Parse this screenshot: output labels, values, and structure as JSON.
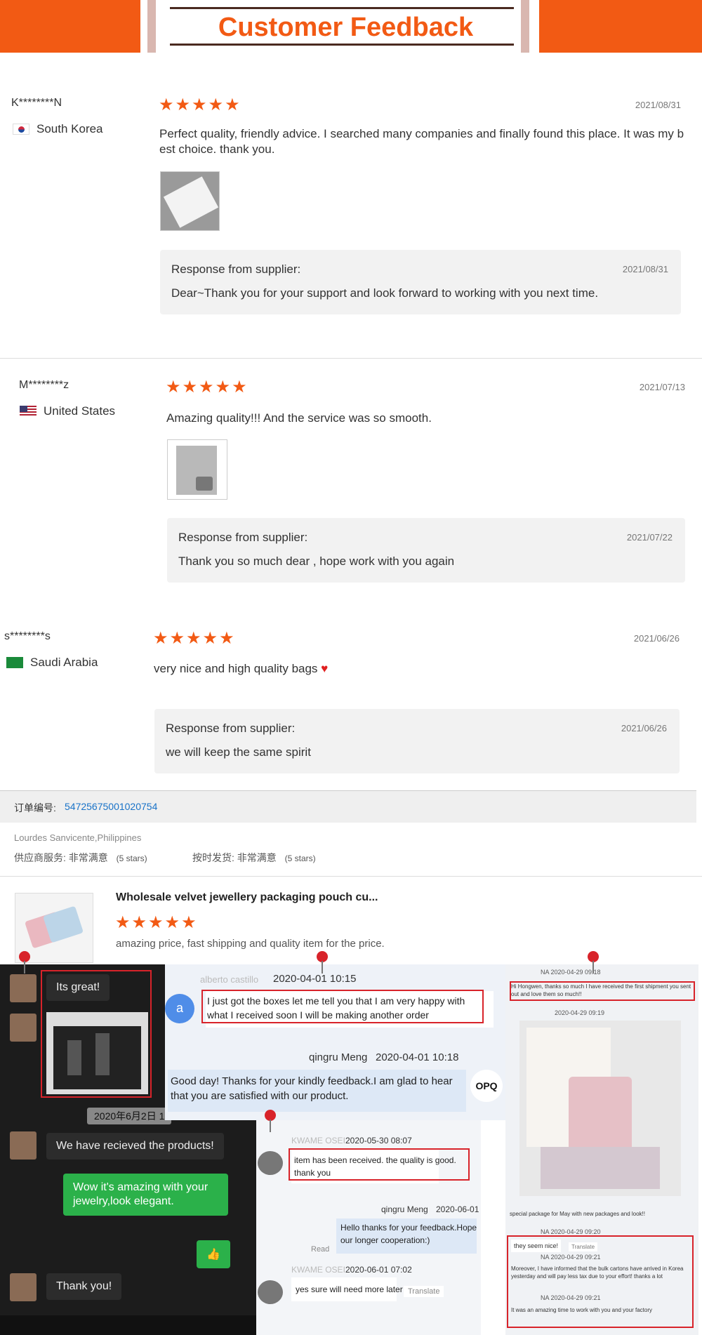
{
  "header": {
    "title": "Customer Feedback"
  },
  "reviews": [
    {
      "name": "K********N",
      "country": "South Korea",
      "stars": "★★★★★",
      "date": "2021/08/31",
      "text": "Perfect quality, friendly advice. I searched many companies and finally found this place. It was my b",
      "text2": "est choice. thank you.",
      "response_label": "Response from supplier:",
      "response_date": "2021/08/31",
      "response": "Dear~Thank you for your support and look forward to working with you next time."
    },
    {
      "name": "M********z",
      "country": "United States",
      "stars": "★★★★★",
      "date": "2021/07/13",
      "text": "Amazing quality!!! And the service was so smooth.",
      "response_label": "Response from supplier:",
      "response_date": "2021/07/22",
      "response": "Thank you so much dear , hope work with you again"
    },
    {
      "name": "s********s",
      "country": "Saudi Arabia",
      "stars": "★★★★★",
      "date": "2021/06/26",
      "text": "very nice and high quality bags",
      "heart": "♥",
      "response_label": "Response from supplier:",
      "response_date": "2021/06/26",
      "response": "we will keep the same spirit"
    }
  ],
  "order": {
    "label": "订单编号:",
    "number": "54725675001020754",
    "buyer": "Lourdes Sanvicente,Philippines",
    "service_label": "供应商服务:",
    "service_value": "非常满意",
    "service_stars": "(5 stars)",
    "ship_label": "按时发货:",
    "ship_value": "非常满意",
    "ship_stars": "(5 stars)",
    "product_title": "Wholesale velvet jewellery packaging pouch cu...",
    "product_stars": "★★★★★",
    "product_review": "amazing price, fast shipping and quality item for the price."
  },
  "chat_left": {
    "msg1": "Its great!",
    "date": "2020年6月2日 1",
    "msg2": "We have recieved the products!",
    "msg3": "Wow it's amazing with your jewelry,look elegant.",
    "msg4": "👍",
    "msg5": "Thank you!"
  },
  "chat_mid": {
    "sender1": "alberto castillo",
    "time1": "2020-04-01 10:15",
    "avatar_letter": "a",
    "msg1": "I just got the boxes let me tell you that I am very happy with what I received soon I will be making another order",
    "sender2": "qingru Meng",
    "time2": "2020-04-01 10:18",
    "msg2": "Good day! Thanks for your kindly feedback.I am glad to hear that you are satisfied with our product.",
    "badge": "OPQ"
  },
  "chat_mid2": {
    "sender1": "KWAME OSEI",
    "time1": "2020-05-30 08:07",
    "msg1": "item has been received. the quality is good.",
    "msg1b": "thank you",
    "sender2": "qingru Meng",
    "time2": "2020-06-01",
    "msg2": "Hello thanks for your feedback.Hope",
    "msg2b": "our longer cooperation:)",
    "read": "Read",
    "sender3": "KWAME OSEI",
    "time3": "2020-06-01 07:02",
    "msg3": "yes sure will need more later",
    "translate": "Translate"
  },
  "chat_right": {
    "h1": "NA  2020-04-29 09:18",
    "msg1": "Hi Hongwen, thanks so much I have received the first shipment you sent out and love them so much!!",
    "t2": "2020-04-29 09:19",
    "msg2": "special package for May with new packages and look!!",
    "h3": "NA  2020-04-29 09:20",
    "msg3": "they seem nice!",
    "translate": "Translate",
    "h4": "NA  2020-04-29 09:21",
    "msg4": "Moreover, I have informed that the bulk cartons have arrived in Korea yesterday and will pay less tax due to your effort! thanks a lot",
    "h5": "NA  2020-04-29 09:21",
    "msg5": "It was an amazing time to work with you and your factory"
  },
  "colors": {
    "accent": "#f25a14",
    "wechat_green": "#2bb14a",
    "red_box": "#d8232a"
  }
}
